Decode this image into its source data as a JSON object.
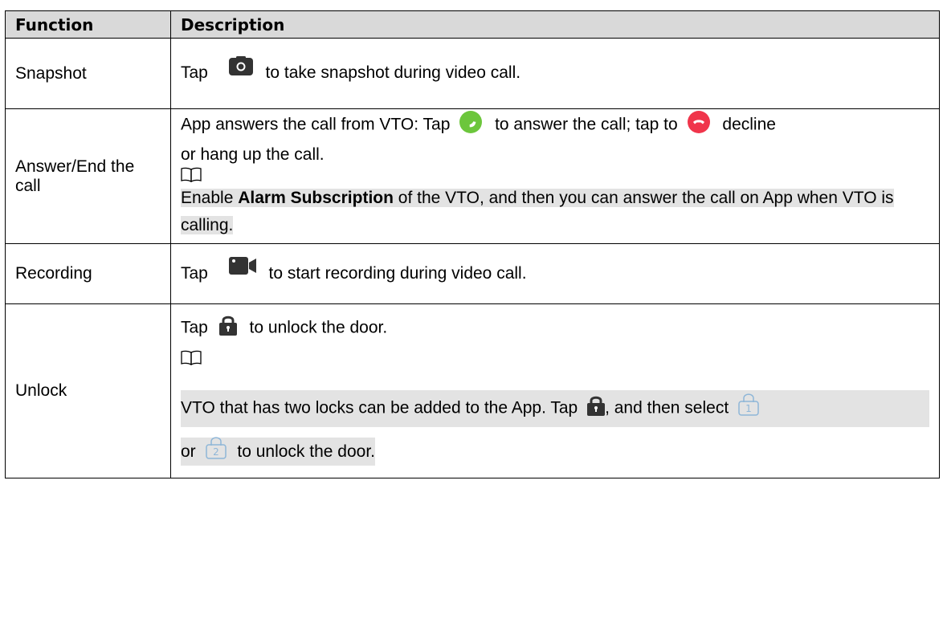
{
  "table": {
    "headers": {
      "function": "Function",
      "description": "Description"
    },
    "rows": [
      {
        "function": "Snapshot",
        "desc_a": "Tap",
        "icon": "camera-icon",
        "desc_b": "to take snapshot during video call."
      },
      {
        "function": "Answer/End the call",
        "line1_a": "App answers the call from VTO: Tap",
        "answer_icon": "answer-call-icon",
        "line1_b": "to answer the call; tap to",
        "hangup_icon": "hang-up-icon",
        "line1_c": "decline",
        "line2": "or hang up the call.",
        "note_icon": "note-book-icon",
        "note_a": "Enable",
        "note_bold": "Alarm Subscription",
        "note_b": "of the VTO, and then you can answer the call on App when VTO is calling."
      },
      {
        "function": "Recording",
        "desc_a": "Tap",
        "icon": "video-camera-icon",
        "desc_b": "to start recording during video call."
      },
      {
        "function": "Unlock",
        "line1_a": "Tap",
        "lock_icon": "lock-icon",
        "line1_b": "to unlock the door.",
        "note_icon": "note-book-icon",
        "note_a": "VTO that has two locks can be added to the App. Tap",
        "note_lock_icon": "lock-icon",
        "note_b": ", and then select",
        "lock1_icon": "lock-1-icon",
        "lock1_label": "1",
        "note_or": "or",
        "lock2_icon": "lock-2-icon",
        "lock2_label": "2",
        "note_c": "to unlock the door."
      }
    ]
  },
  "colors": {
    "header_bg": "#d9d9d9",
    "note_highlight": "#e3e3e3",
    "answer_green": "#6cc63c",
    "hangup_red": "#f0354b",
    "icon_dark": "#333333",
    "lock_outline": "#8eb6d8"
  }
}
